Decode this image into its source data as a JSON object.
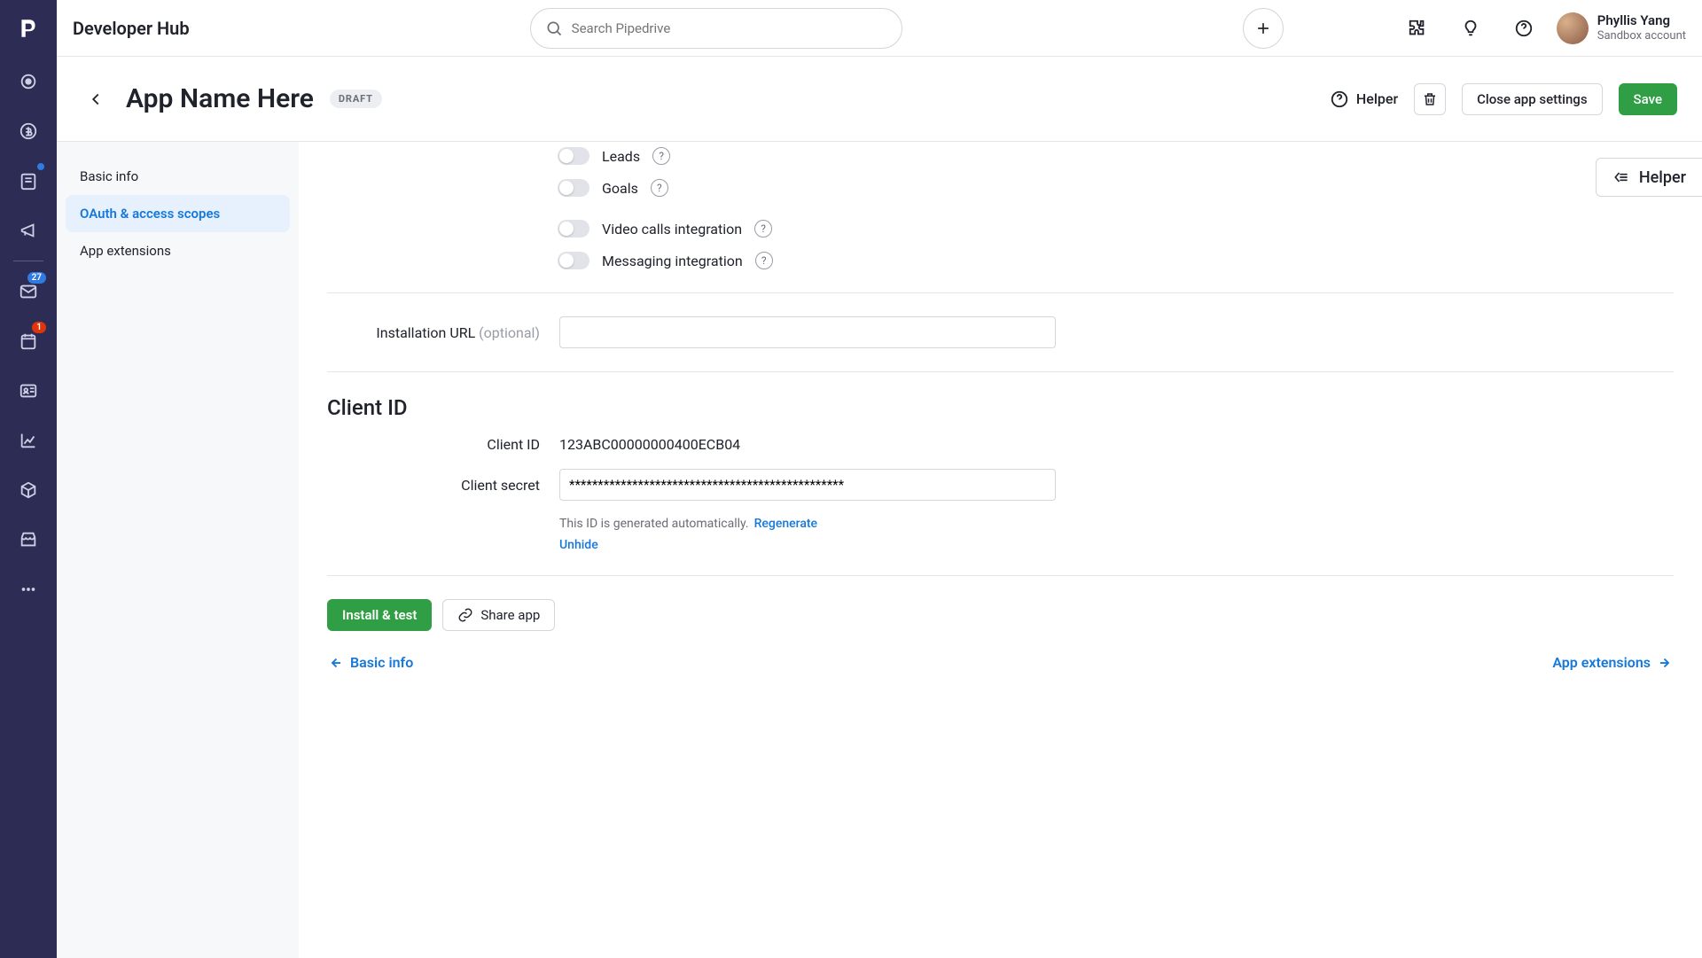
{
  "topbar": {
    "hub_title": "Developer Hub",
    "search_placeholder": "Search Pipedrive",
    "user_name": "Phyllis Yang",
    "user_sub": "Sandbox account"
  },
  "nav": {
    "badge_inbox": "27",
    "badge_alert": "1"
  },
  "app_header": {
    "back_aria": "Back",
    "title": "App Name Here",
    "status": "DRAFT",
    "helper": "Helper",
    "close": "Close app settings",
    "save": "Save"
  },
  "sidebar": {
    "items": [
      {
        "label": "Basic info"
      },
      {
        "label": "OAuth & access scopes"
      },
      {
        "label": "App extensions"
      }
    ]
  },
  "helper_tab": "Helper",
  "scopes": {
    "leads": "Leads",
    "goals": "Goals",
    "video": "Video calls integration",
    "messaging": "Messaging integration"
  },
  "install_url": {
    "label": "Installation URL",
    "optional": "(optional)",
    "value": ""
  },
  "client": {
    "section_title": "Client ID",
    "id_label": "Client ID",
    "id_value": "123ABC00000000400ECB04",
    "secret_label": "Client secret",
    "secret_value": "************************************************",
    "hint": "This ID is generated automatically.",
    "regenerate": "Regenerate",
    "unhide": "Unhide"
  },
  "actions": {
    "install_test": "Install & test",
    "share_app": "Share app"
  },
  "pager": {
    "prev": "Basic info",
    "next": "App extensions"
  }
}
